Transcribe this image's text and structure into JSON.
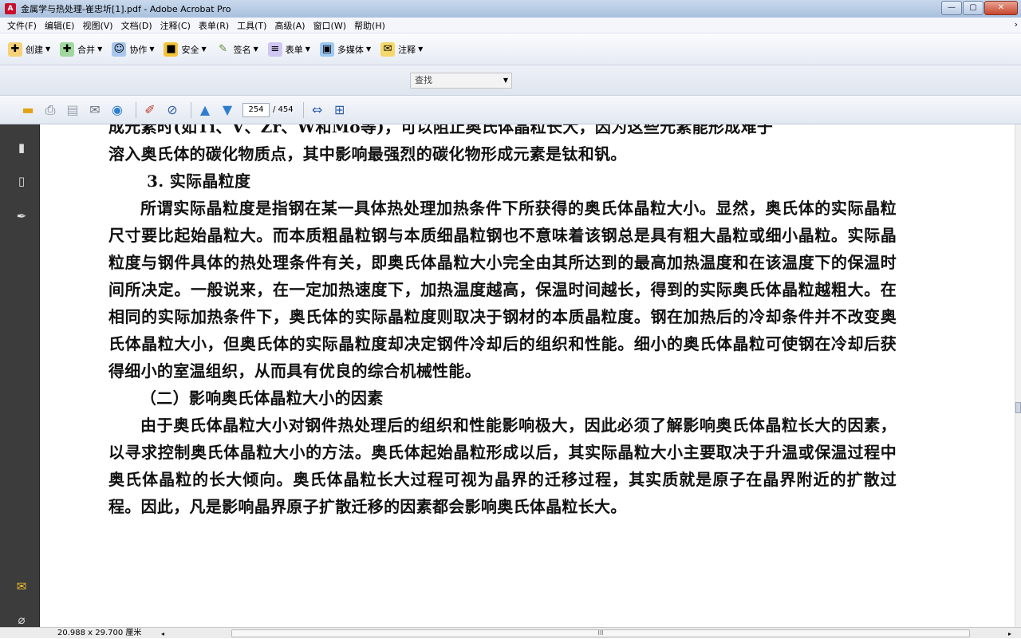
{
  "window": {
    "title": "金属学与热处理-崔忠圻[1].pdf - Adobe Acrobat Pro",
    "app_icon": "acrobat-icon",
    "buttons": {
      "minimize": "—",
      "maximize": "▢",
      "close": "✕"
    }
  },
  "menu": [
    "文件(F)",
    "编辑(E)",
    "视图(V)",
    "文档(D)",
    "注释(C)",
    "表单(R)",
    "工具(T)",
    "高级(A)",
    "窗口(W)",
    "帮助(H)"
  ],
  "menu_overflow": "›",
  "tasks": [
    {
      "label": "创建",
      "icon": "create-icon",
      "color": "#d89a1e"
    },
    {
      "label": "合并",
      "icon": "combine-icon",
      "color": "#3aa33a"
    },
    {
      "label": "协作",
      "icon": "collaborate-icon",
      "color": "#3a78c8"
    },
    {
      "label": "安全",
      "icon": "lock-icon",
      "color": "#e0a312"
    },
    {
      "label": "签名",
      "icon": "pen-icon",
      "color": "#5f8a2c"
    },
    {
      "label": "表单",
      "icon": "form-icon",
      "color": "#6a5acd"
    },
    {
      "label": "多媒体",
      "icon": "multimedia-icon",
      "color": "#2f7fd1"
    },
    {
      "label": "注释",
      "icon": "comment-icon",
      "color": "#f2c12e"
    }
  ],
  "find": {
    "placeholder": "查找"
  },
  "nav": {
    "current_page": "254",
    "total_pages": "/ 454"
  },
  "document": {
    "paragraphs": [
      "成元素时(如Ti、V、Zr、W和Mo等)，可以阻止奥氏体晶粒长大，因为这些元素能形成难于",
      "溶入奥氏体的碳化物质点，其中影响最强烈的碳化物形成元素是钛和钒。",
      "3. 实际晶粒度",
      "所谓实际晶粒度是指钢在某一具体热处理加热条件下所获得的奥氏体晶粒大小。显然，奥氏体的实际晶粒尺寸要比起始晶粒大。而本质粗晶粒钢与本质细晶粒钢也不意味着该钢总是具有粗大晶粒或细小晶粒。实际晶粒度与钢件具体的热处理条件有关，即奥氏体晶粒大小完全由其所达到的最高加热温度和在该温度下的保温时间所决定。一般说来，在一定加热速度下，加热温度越高，保温时间越长，得到的实际奥氏体晶粒越粗大。在相同的实际加热条件下，奥氏体的实际晶粒度则取决于钢材的本质晶粒度。钢在加热后的冷却条件并不改变奥氏体晶粒大小，但奥氏体的实际晶粒度却决定钢件冷却后的组织和性能。细小的奥氏体晶粒可使钢在冷却后获得细小的室温组织，从而具有优良的综合机械性能。",
      "（二）影响奥氏体晶粒大小的因素",
      "由于奥氏体晶粒大小对钢件热处理后的组织和性能影响极大，因此必须了解影响奥氏体晶粒长大的因素，以寻求控制奥氏体晶粒大小的方法。奥氏体起始晶粒形成以后，其实际晶粒大小主要取决于升温或保温过程中奥氏体晶粒的长大倾向。奥氏体晶粒长大过程可视为晶界的迁移过程，其实质就是原子在晶界附近的扩散过程。因此，凡是影响晶界原子扩散迁移的因素都会影响奥氏体晶粒长大。"
    ]
  },
  "status": {
    "page_size": "20.988 x 29.700 厘米",
    "scroll_grip": "III"
  }
}
